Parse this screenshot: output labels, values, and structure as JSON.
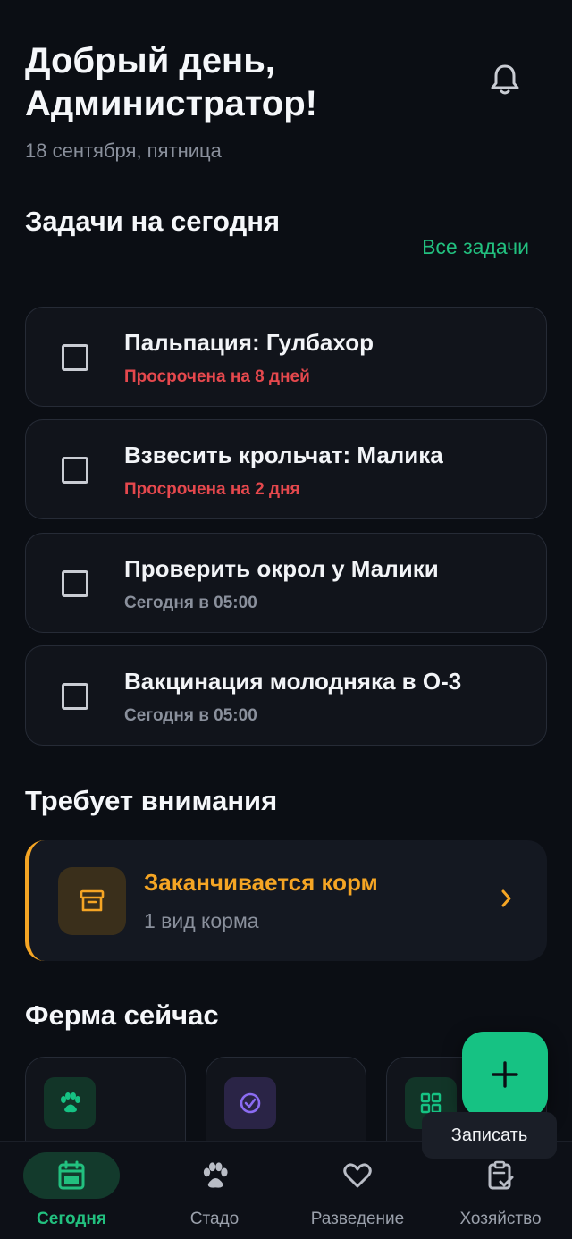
{
  "header": {
    "greeting": "Добрый день, Администратор!",
    "date": "18 сентября, пятница",
    "notification_icon": "bell-icon"
  },
  "tasks_section": {
    "title": "Задачи на сегодня",
    "all_link": "Все задачи",
    "items": [
      {
        "title": "Пальпация: Гулбахор",
        "subtitle": "Просрочена на 8 дней",
        "status": "overdue"
      },
      {
        "title": "Взвесить крольчат: Малика",
        "subtitle": "Просрочена на 2 дня",
        "status": "overdue"
      },
      {
        "title": "Проверить окрол у Малики",
        "subtitle": "Сегодня в 05:00",
        "status": "normal"
      },
      {
        "title": "Вакцинация молодняка в О-3",
        "subtitle": "Сегодня в 05:00",
        "status": "normal"
      }
    ]
  },
  "attention_section": {
    "title": "Требует внимания",
    "alert": {
      "title": "Заканчивается корм",
      "subtitle": "1 вид корма",
      "icon": "archive-box-icon"
    }
  },
  "farm_section": {
    "title": "Ферма сейчас",
    "cards": [
      {
        "icon": "paw-icon"
      },
      {
        "icon": "check-circle-icon"
      },
      {
        "icon": "grid-icon"
      }
    ]
  },
  "fab": {
    "icon": "plus-icon",
    "label": "Записать"
  },
  "bottom_nav": {
    "items": [
      {
        "label": "Сегодня",
        "icon": "calendar-icon",
        "active": true
      },
      {
        "label": "Стадо",
        "icon": "paw-icon",
        "active": false
      },
      {
        "label": "Разведение",
        "icon": "heart-icon",
        "active": false
      },
      {
        "label": "Хозяйство",
        "icon": "clipboard-check-icon",
        "active": false
      }
    ]
  },
  "colors": {
    "background": "#0b0e14",
    "accent_green": "#16c283",
    "overdue_red": "#e5484d",
    "warning_orange": "#f5a524"
  }
}
